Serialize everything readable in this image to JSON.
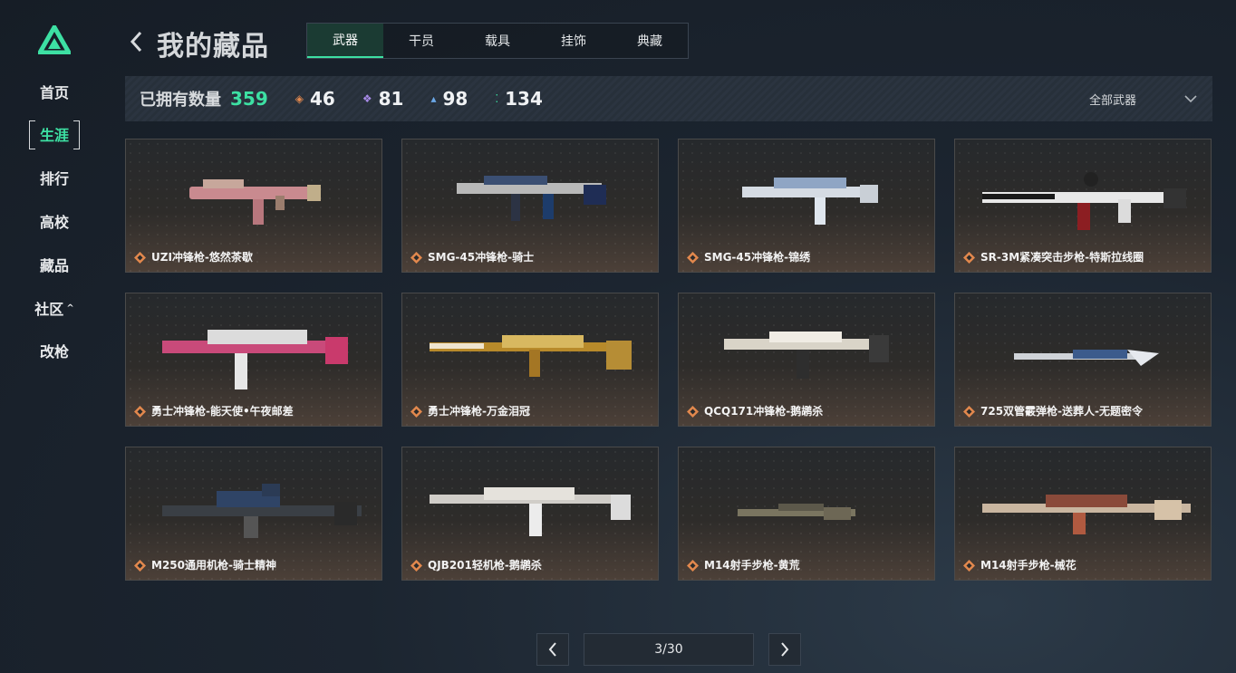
{
  "colors": {
    "accent": "#3de0a3",
    "rarity_orange": "#e2884d",
    "rarity_purple": "#a88be8",
    "rarity_blue": "#6ba8e8",
    "rarity_green": "#3de0a3"
  },
  "sidebar": {
    "logo_icon": "triangle-logo-icon",
    "items": [
      {
        "label": "首页"
      },
      {
        "label": "生涯"
      },
      {
        "label": "排行"
      },
      {
        "label": "高校"
      },
      {
        "label": "藏品"
      },
      {
        "label": "社区"
      },
      {
        "label": "改枪"
      }
    ],
    "active_index": 1
  },
  "header": {
    "title": "我的藏品",
    "tabs": [
      {
        "label": "武器"
      },
      {
        "label": "干员"
      },
      {
        "label": "载具"
      },
      {
        "label": "挂饰"
      },
      {
        "label": "典藏"
      }
    ],
    "active_tab": 0
  },
  "stats": {
    "owned_label": "已拥有数量",
    "owned_count": "359",
    "counts": [
      {
        "icon": "orange-diamond-icon",
        "value": "46"
      },
      {
        "icon": "purple-diamond-icon",
        "value": "81"
      },
      {
        "icon": "blue-diamond-icon",
        "value": "98"
      },
      {
        "icon": "green-dots-icon",
        "value": "134"
      }
    ],
    "filter_label": "全部武器"
  },
  "items": [
    {
      "name": "UZI冲锋枪-悠然茶歇"
    },
    {
      "name": "SMG-45冲锋枪-骑士"
    },
    {
      "name": "SMG-45冲锋枪-锦绣"
    },
    {
      "name": "SR-3M紧凑突击步枪-特斯拉线圈"
    },
    {
      "name": "勇士冲锋枪-能天使•午夜邮差"
    },
    {
      "name": "勇士冲锋枪-万金泪冠"
    },
    {
      "name": "QCQ171冲锋枪-鹅鹕杀"
    },
    {
      "name": "725双管霰弹枪-送葬人-无题密令"
    },
    {
      "name": "M250通用机枪-骑士精神"
    },
    {
      "name": "QJB201轻机枪-鹅鹕杀"
    },
    {
      "name": "M14射手步枪-黄荒"
    },
    {
      "name": "M14射手步枪-械花"
    }
  ],
  "pagination": {
    "text": "3/30"
  }
}
